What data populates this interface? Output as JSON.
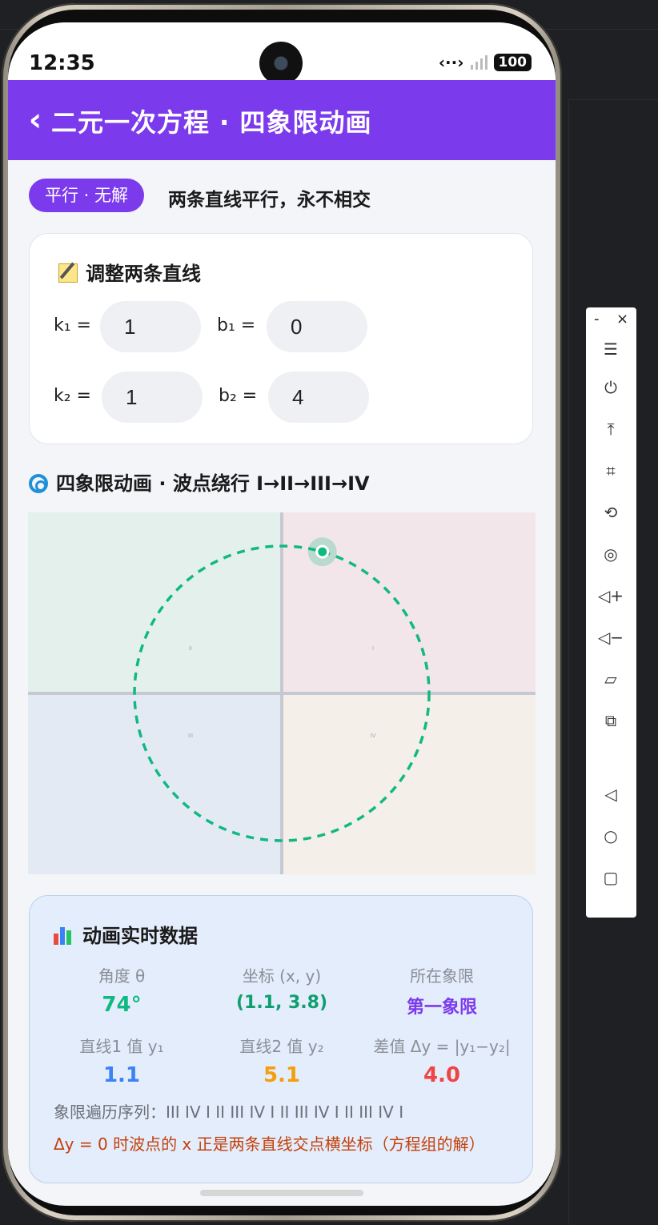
{
  "status_bar": {
    "time": "12:35",
    "battery": "100"
  },
  "header": {
    "title": "二元一次方程 · 四象限动画",
    "back_icon": "chevron-left-icon"
  },
  "relation": {
    "badge": "平行 · 无解",
    "description": "两条直线平行，永不相交"
  },
  "input_card": {
    "title": "调整两条直线",
    "k1_label": "k₁ =",
    "k1_value": "1",
    "b1_label": "b₁ =",
    "b1_value": "0",
    "k2_label": "k₂ =",
    "k2_value": "1",
    "b2_label": "b₂ =",
    "b2_value": "4"
  },
  "animation": {
    "title": "四象限动画 · 波点绕行 I→II→III→IV",
    "quadrant_labels": {
      "q1": "I",
      "q2": "II",
      "q3": "III",
      "q4": "IV"
    },
    "quadrant_colors": {
      "q1": "#f3e6ea",
      "q2": "#e4f0ec",
      "q3": "#e4eaf4",
      "q4": "#f4efe9"
    },
    "dot_angle_deg": 74,
    "accent": "#10b981"
  },
  "data_card": {
    "title": "动画实时数据",
    "angle_label": "角度 θ",
    "angle_value": "74°",
    "coord_label": "坐标 (x, y)",
    "coord_value": "(1.1, 3.8)",
    "quadrant_label": "所在象限",
    "quadrant_value": "第一象限",
    "y1_label": "直线1 值 y₁",
    "y1_value": "1.1",
    "y2_label": "直线2 值 y₂",
    "y2_value": "5.1",
    "diff_label": "差值 Δy = |y₁−y₂|",
    "diff_value": "4.0",
    "sequence": "象限遍历序列：III IV I II III IV I II III IV I II III IV I",
    "note": "Δy = 0 时波点的 x 正是两条直线交点横坐标（方程组的解）",
    "colors": {
      "angle": "#10b981",
      "coord": "#0f9f6e",
      "quadrant": "#7c3aed",
      "y1": "#3b82f6",
      "y2": "#f59e0b",
      "diff": "#ef4444"
    }
  },
  "toolbar": {
    "minimize": "-",
    "close": "×",
    "icons": [
      "menu-icon",
      "power-icon",
      "pin-top-icon",
      "crop-icon",
      "rotate-icon",
      "record-icon",
      "volume-up-icon",
      "volume-down-icon",
      "rotate-device-icon",
      "screenshot-icon",
      "back-icon",
      "home-icon",
      "recents-icon"
    ]
  }
}
